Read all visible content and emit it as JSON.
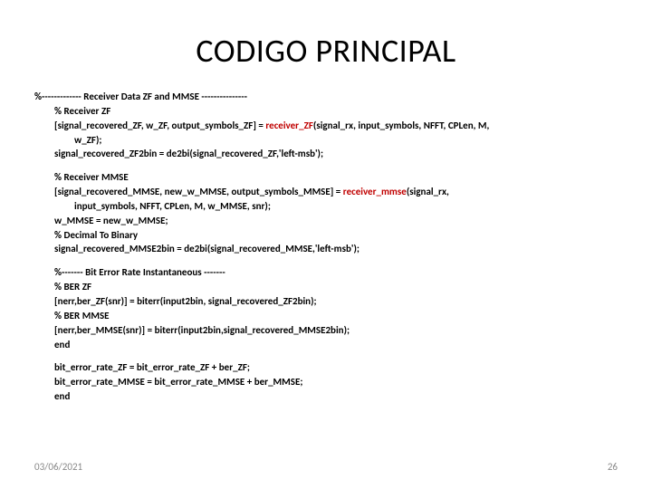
{
  "title": "CODIGO PRINCIPAL",
  "lines": {
    "l1": "%------------- Receiver Data ZF and MMSE ---------------",
    "l2": "% Receiver ZF",
    "l3a": "[signal_recovered_ZF, w_ZF, output_symbols_ZF] = ",
    "l3b": "receiver_ZF",
    "l3c": "(signal_rx, input_symbols, NFFT, CPLen, M,",
    "l3d": "w_ZF);",
    "l4": "signal_recovered_ZF2bin = de2bi(signal_recovered_ZF,'left-msb');",
    "l5": "% Receiver MMSE",
    "l6a": "[signal_recovered_MMSE, new_w_MMSE, output_symbols_MMSE] = ",
    "l6b": "receiver_mmse",
    "l6c": "(signal_rx,",
    "l6d": "input_symbols, NFFT, CPLen, M, w_MMSE, snr);",
    "l7": "w_MMSE = new_w_MMSE;",
    "l8": "% Decimal To Binary",
    "l9": "signal_recovered_MMSE2bin = de2bi(signal_recovered_MMSE,'left-msb');",
    "l10": "%------- Bit Error Rate Instantaneous -------",
    "l11": "% BER ZF",
    "l12": "[nerr,ber_ZF(snr)] = biterr(input2bin, signal_recovered_ZF2bin);",
    "l13": "% BER MMSE",
    "l14": "[nerr,ber_MMSE(snr)] = biterr(input2bin,signal_recovered_MMSE2bin);",
    "l15": "end",
    "l16": "bit_error_rate_ZF = bit_error_rate_ZF + ber_ZF;",
    "l17": "bit_error_rate_MMSE = bit_error_rate_MMSE + ber_MMSE;",
    "l18": "end"
  },
  "footer": {
    "date": "03/06/2021",
    "page": "26"
  }
}
